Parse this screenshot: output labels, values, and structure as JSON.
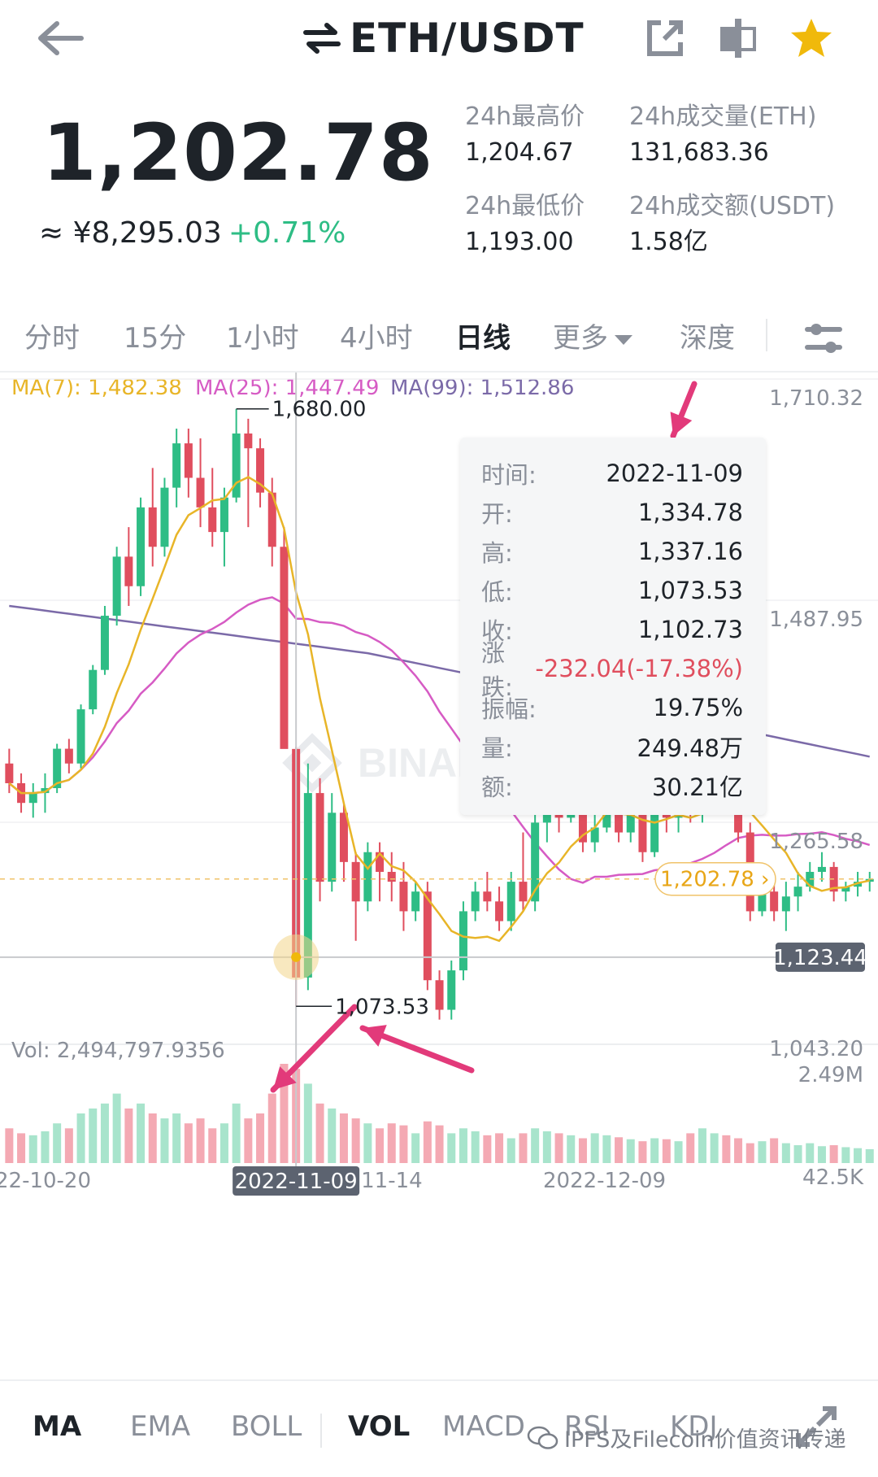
{
  "header": {
    "title": "ETH/USDT",
    "back_icon": "arrow-left-icon",
    "icons": [
      "share-icon",
      "split-screen-icon",
      "star-icon"
    ],
    "star_color": "#f0b90b"
  },
  "price": {
    "last": "1,202.78",
    "cny": "≈ ¥8,295.03",
    "change": "+0.71%"
  },
  "stats": {
    "high_label": "24h最高价",
    "high_value": "1,204.67",
    "volume_label": "24h成交量(ETH)",
    "volume_value": "131,683.36",
    "low_label": "24h最低价",
    "low_value": "1,193.00",
    "turnover_label": "24h成交额(USDT)",
    "turnover_value": "1.58亿"
  },
  "tabs": [
    "分时",
    "15分",
    "1小时",
    "4小时",
    "日线",
    "更多",
    "深度"
  ],
  "active_tab": "日线",
  "ma_legend": {
    "ma7": "MA(7): 1,482.38",
    "ma25": "MA(25): 1,447.49",
    "ma99": "MA(99): 1,512.86"
  },
  "colors": {
    "up": "#2ebd85",
    "down": "#e04e5e",
    "ma7": "#e8b528",
    "ma25": "#d65bc4",
    "ma99": "#7b6aa8",
    "annotation_arrow": "#e23a7a"
  },
  "price_axis": {
    "labels": [
      "1,710.32",
      "1,487.95",
      "1,265.58",
      "1,043.20"
    ],
    "crosshair_price": "1,123.44",
    "current_price_tag": "1,202.78"
  },
  "annotations": {
    "high_marker": "1,680.00",
    "low_marker": "1,073.53"
  },
  "tooltip": {
    "rows": [
      {
        "k": "时间:",
        "v": "2022-11-09"
      },
      {
        "k": "开:",
        "v": "1,334.78"
      },
      {
        "k": "高:",
        "v": "1,337.16"
      },
      {
        "k": "低:",
        "v": "1,073.53"
      },
      {
        "k": "收:",
        "v": "1,102.73"
      },
      {
        "k": "涨跌:",
        "v": "-232.04(-17.38%)"
      },
      {
        "k": "振幅:",
        "v": "19.75%"
      },
      {
        "k": "量:",
        "v": "249.48万"
      },
      {
        "k": "额:",
        "v": "30.21亿"
      }
    ]
  },
  "volume": {
    "label": "Vol: 2,494,797.9356",
    "axis_top": "2.49M",
    "axis_bottom": "42.5K"
  },
  "date_axis": {
    "left": "22-10-20",
    "crosshair": "2022-11-09",
    "mid": "11-14",
    "right": "2022-12-09"
  },
  "chart_data": {
    "type": "candlestick",
    "pair": "ETH/USDT",
    "interval": "日线",
    "ylim": [
      1043.2,
      1710.32
    ],
    "ohlc": [
      [
        1320,
        1335,
        1290,
        1300
      ],
      [
        1300,
        1310,
        1270,
        1280
      ],
      [
        1280,
        1300,
        1265,
        1290
      ],
      [
        1290,
        1310,
        1270,
        1295
      ],
      [
        1295,
        1340,
        1290,
        1335
      ],
      [
        1335,
        1345,
        1310,
        1320
      ],
      [
        1320,
        1380,
        1315,
        1375
      ],
      [
        1375,
        1420,
        1370,
        1415
      ],
      [
        1415,
        1480,
        1410,
        1470
      ],
      [
        1470,
        1540,
        1460,
        1530
      ],
      [
        1530,
        1560,
        1480,
        1500
      ],
      [
        1500,
        1590,
        1490,
        1580
      ],
      [
        1580,
        1620,
        1520,
        1540
      ],
      [
        1540,
        1610,
        1530,
        1600
      ],
      [
        1600,
        1660,
        1580,
        1645
      ],
      [
        1645,
        1660,
        1590,
        1610
      ],
      [
        1610,
        1650,
        1560,
        1580
      ],
      [
        1580,
        1620,
        1540,
        1555
      ],
      [
        1555,
        1600,
        1520,
        1590
      ],
      [
        1590,
        1680,
        1585,
        1655
      ],
      [
        1655,
        1670,
        1560,
        1640
      ],
      [
        1640,
        1650,
        1580,
        1595
      ],
      [
        1595,
        1610,
        1520,
        1540
      ],
      [
        1540,
        1560,
        1420,
        1334.78
      ],
      [
        1334.78,
        1337.16,
        1073.53,
        1102.73
      ],
      [
        1102.73,
        1320,
        1090,
        1290
      ],
      [
        1290,
        1305,
        1180,
        1200
      ],
      [
        1200,
        1290,
        1190,
        1270
      ],
      [
        1270,
        1280,
        1200,
        1220
      ],
      [
        1220,
        1230,
        1140,
        1180
      ],
      [
        1180,
        1240,
        1170,
        1230
      ],
      [
        1230,
        1240,
        1180,
        1210
      ],
      [
        1210,
        1230,
        1180,
        1200
      ],
      [
        1200,
        1220,
        1150,
        1170
      ],
      [
        1170,
        1200,
        1160,
        1190
      ],
      [
        1190,
        1200,
        1090,
        1100
      ],
      [
        1100,
        1110,
        1060,
        1070
      ],
      [
        1070,
        1120,
        1060,
        1110
      ],
      [
        1110,
        1180,
        1100,
        1170
      ],
      [
        1170,
        1200,
        1160,
        1190
      ],
      [
        1190,
        1210,
        1170,
        1180
      ],
      [
        1180,
        1195,
        1150,
        1160
      ],
      [
        1160,
        1210,
        1150,
        1200
      ],
      [
        1200,
        1250,
        1170,
        1180
      ],
      [
        1180,
        1270,
        1170,
        1260
      ],
      [
        1260,
        1300,
        1240,
        1290
      ],
      [
        1290,
        1300,
        1250,
        1265
      ],
      [
        1265,
        1300,
        1260,
        1295
      ],
      [
        1295,
        1300,
        1230,
        1240
      ],
      [
        1240,
        1270,
        1230,
        1255
      ],
      [
        1255,
        1300,
        1250,
        1290
      ],
      [
        1290,
        1300,
        1240,
        1250
      ],
      [
        1250,
        1290,
        1240,
        1280
      ],
      [
        1280,
        1290,
        1220,
        1230
      ],
      [
        1230,
        1280,
        1225,
        1275
      ],
      [
        1275,
        1300,
        1250,
        1265
      ],
      [
        1265,
        1290,
        1250,
        1285
      ],
      [
        1285,
        1290,
        1260,
        1270
      ],
      [
        1270,
        1290,
        1260,
        1280
      ],
      [
        1280,
        1350,
        1270,
        1340
      ],
      [
        1340,
        1360,
        1290,
        1300
      ],
      [
        1300,
        1310,
        1240,
        1250
      ],
      [
        1250,
        1260,
        1160,
        1170
      ],
      [
        1170,
        1200,
        1165,
        1190
      ],
      [
        1190,
        1200,
        1160,
        1170
      ],
      [
        1170,
        1200,
        1150,
        1185
      ],
      [
        1185,
        1210,
        1170,
        1195
      ],
      [
        1195,
        1220,
        1190,
        1210
      ],
      [
        1210,
        1230,
        1200,
        1215
      ],
      [
        1215,
        1220,
        1180,
        1190
      ],
      [
        1190,
        1200,
        1180,
        1195
      ],
      [
        1195,
        1210,
        1185,
        1200
      ],
      [
        1200,
        1210,
        1190,
        1202.78
      ]
    ],
    "volume": [
      0.35,
      0.3,
      0.28,
      0.32,
      0.4,
      0.35,
      0.5,
      0.55,
      0.6,
      0.7,
      0.55,
      0.6,
      0.5,
      0.45,
      0.5,
      0.4,
      0.45,
      0.35,
      0.4,
      0.6,
      0.45,
      0.5,
      0.7,
      1.0,
      0.95,
      0.8,
      0.6,
      0.55,
      0.5,
      0.45,
      0.4,
      0.35,
      0.4,
      0.38,
      0.3,
      0.42,
      0.38,
      0.3,
      0.35,
      0.32,
      0.28,
      0.3,
      0.25,
      0.3,
      0.35,
      0.32,
      0.3,
      0.28,
      0.25,
      0.3,
      0.28,
      0.26,
      0.24,
      0.22,
      0.25,
      0.24,
      0.22,
      0.3,
      0.35,
      0.3,
      0.28,
      0.25,
      0.2,
      0.22,
      0.25,
      0.2,
      0.18,
      0.2,
      0.17,
      0.18,
      0.16,
      0.15,
      0.14
    ]
  },
  "indicators": [
    "MA",
    "EMA",
    "BOLL",
    "VOL",
    "MACD",
    "RSI",
    "KDJ"
  ],
  "indicators_active": [
    "MA",
    "VOL"
  ],
  "watermark": "IPFS及Filecoin价值资讯传递"
}
